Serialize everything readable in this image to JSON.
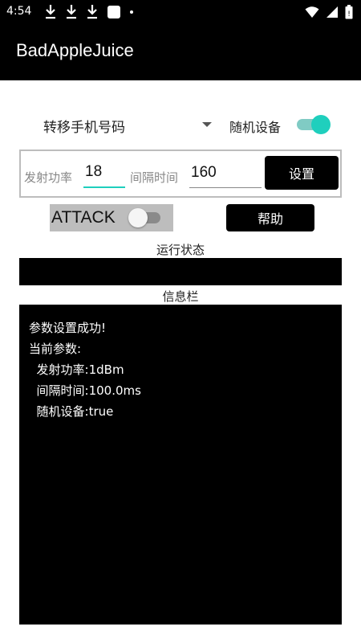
{
  "status_bar": {
    "time": "4:54"
  },
  "app_bar": {
    "title": "BadAppleJuice"
  },
  "controls": {
    "mode_select": "转移手机号码",
    "random_device_label": "随机设备",
    "random_device_on": true
  },
  "params": {
    "power_label": "发射功率",
    "power_value": "18",
    "interval_label": "间隔时间",
    "interval_value": "160",
    "set_button": "设置"
  },
  "attack": {
    "label": "ATTACK",
    "on": false
  },
  "help_button": "帮助",
  "run_status": {
    "title": "运行状态"
  },
  "info": {
    "title": "信息栏",
    "lines": [
      "参数设置成功!",
      "当前参数:",
      "  发射功率:1dBm",
      "  间隔时间:100.0ms",
      "  随机设备:true"
    ]
  },
  "colors": {
    "accent": "#1fcfbd",
    "bar_background": "#000000"
  }
}
